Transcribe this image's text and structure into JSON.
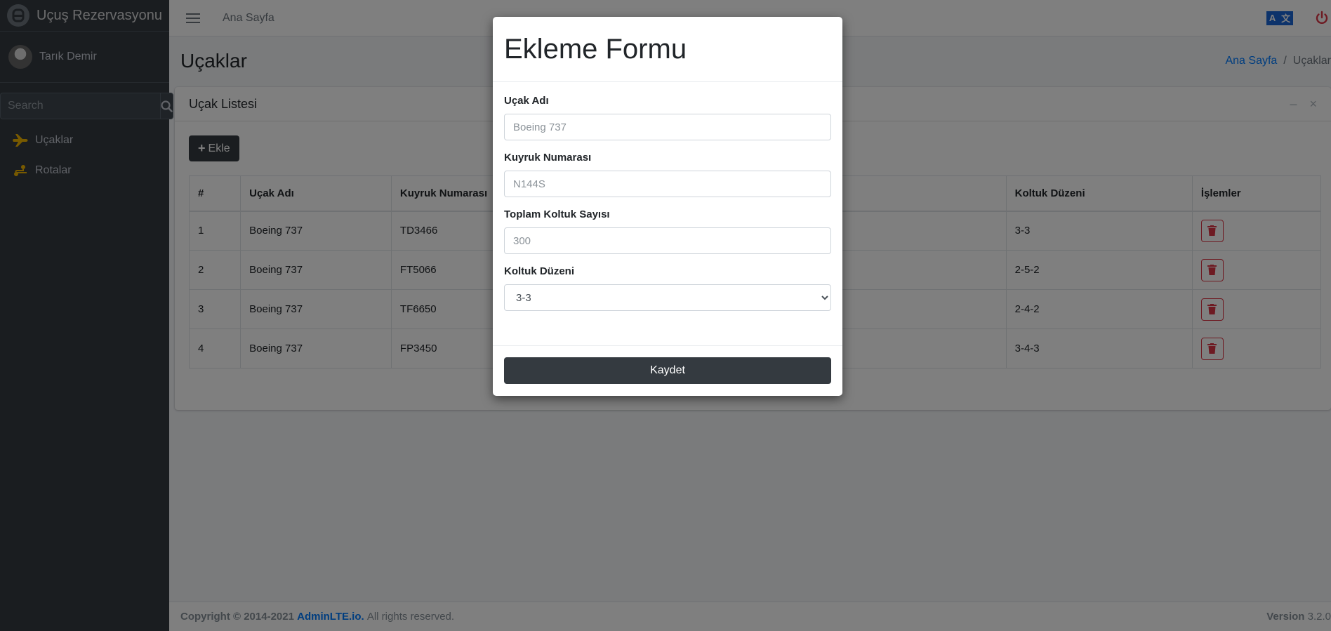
{
  "sidebar": {
    "brand": "Uçuş Rezervasyonu",
    "user": "Tarık Demir",
    "search_placeholder": "Search",
    "items": [
      {
        "label": "Uçaklar",
        "icon": "plane-icon"
      },
      {
        "label": "Rotalar",
        "icon": "route-icon"
      }
    ]
  },
  "topbar": {
    "home_link": "Ana Sayfa",
    "lang_left": "A",
    "lang_right": "文"
  },
  "header": {
    "title": "Uçaklar",
    "breadcrumb_home": "Ana Sayfa",
    "breadcrumb_sep": "/",
    "breadcrumb_current": "Uçaklar"
  },
  "card": {
    "title": "Uçak Listesi",
    "minimize": "–",
    "close": "×",
    "add_label": "Ekle"
  },
  "table": {
    "headers": [
      "#",
      "Uçak Adı",
      "Kuyruk Numarası",
      "",
      "Koltuk Düzeni",
      "İşlemler"
    ],
    "rows": [
      {
        "no": "1",
        "name": "Boeing 737",
        "tail": "TD3466",
        "layout": "3-3"
      },
      {
        "no": "2",
        "name": "Boeing 737",
        "tail": "FT5066",
        "layout": "2-5-2"
      },
      {
        "no": "3",
        "name": "Boeing 737",
        "tail": "TF6650",
        "layout": "2-4-2"
      },
      {
        "no": "4",
        "name": "Boeing 737",
        "tail": "FP3450",
        "layout": "3-4-3"
      }
    ]
  },
  "footer": {
    "copyright": "Copyright © 2014-2021",
    "link": "AdminLTE.io.",
    "rights": "All rights reserved.",
    "version_label": "Version",
    "version": "3.2.0"
  },
  "modal": {
    "title": "Ekleme Formu",
    "fields": {
      "name_label": "Uçak Adı",
      "name_placeholder": "Boeing 737",
      "tail_label": "Kuyruk Numarası",
      "tail_placeholder": "N144S",
      "seats_label": "Toplam Koltuk Sayısı",
      "seats_placeholder": "300",
      "layout_label": "Koltuk Düzeni",
      "layout_selected": "3-3"
    },
    "save_label": "Kaydet"
  },
  "colors": {
    "sidebar_bg": "#343a40",
    "accent_link": "#007bff",
    "danger": "#dc3545",
    "plane_icon": "#f0b400"
  }
}
